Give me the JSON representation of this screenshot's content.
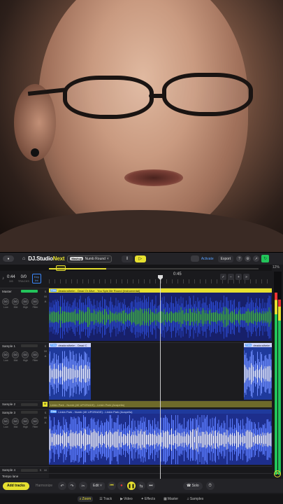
{
  "topbar": {
    "logo_dj": "DJ.",
    "logo_studio": "Studio",
    "logo_next": "Next",
    "project_badge": "Mashup",
    "project_name": "Numb Round",
    "activate": "Activate",
    "export": "Export"
  },
  "zoom_percent": "12%",
  "transport": {
    "time": "0:44",
    "time_sub": "2/8",
    "bars": "0/0",
    "bars_sub": "TRACKS",
    "key_top": "Key",
    "key_bottom": "Int"
  },
  "ruler": {
    "playhead_time": "0:45"
  },
  "tracks": [
    {
      "name": "Master",
      "clip": "deadcraiheim - Dead Or Alive - You Spin Me Round (Instrumental)",
      "tag": "Files"
    },
    {
      "name": "Sample 1",
      "clip": "deadcraiheim - Dead C",
      "clip2": "deadcraiheim",
      "tag": "Files"
    },
    {
      "name": "Sample 2",
      "clip": "Linkin Park - Numb (4K UPGRADE) - Linkin Park (Acapella)"
    },
    {
      "name": "Sample 3",
      "clip": "Linkin Park - Numb (4K UPGRADE) - Linkin Park (Acapella)",
      "tag": "Files"
    },
    {
      "name": "Sample 4"
    },
    {
      "name": "Tempo lane"
    }
  ],
  "knob_labels": [
    "Low",
    "Mid",
    "High",
    "Filter"
  ],
  "knob_value": "0.0",
  "bottombar": {
    "add_tracks": "Add tracks",
    "harmonize": "Harmonize",
    "edit": "Edit",
    "solo": "Solo"
  },
  "nav": {
    "zoom": "Zoom",
    "track": "Track",
    "video": "Video",
    "effects": "Effects",
    "master": "Master",
    "samples": "Samples"
  },
  "colors": {
    "accent": "#e6e030",
    "green": "#23c45a",
    "wave_blue": "#1f2b8a",
    "wave_green": "#2f8a3a"
  }
}
